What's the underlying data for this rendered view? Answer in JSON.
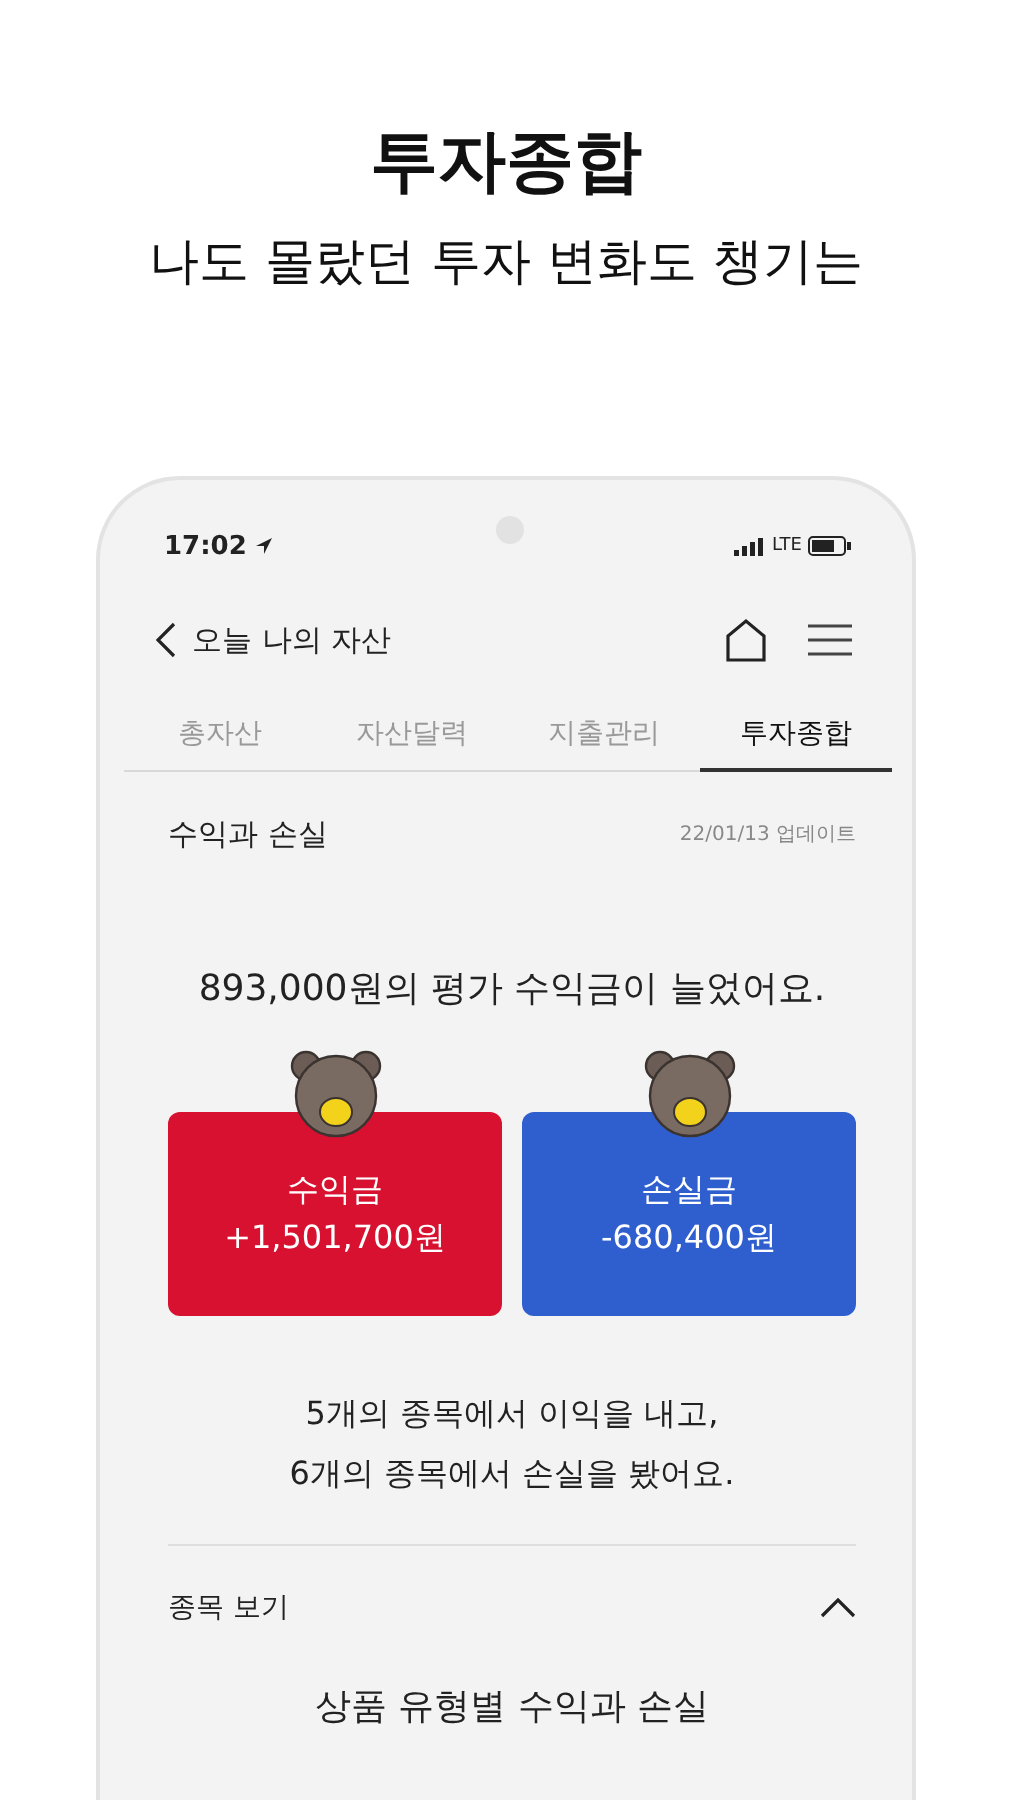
{
  "promo": {
    "title": "투자종합",
    "subtitle": "나도 몰랐던 투자 변화도 챙기는"
  },
  "status_bar": {
    "time": "17:02",
    "network": "LTE"
  },
  "nav": {
    "title": "오늘 나의 자산"
  },
  "tabs": [
    {
      "label": "총자산",
      "selected": false
    },
    {
      "label": "자산달력",
      "selected": false
    },
    {
      "label": "지출관리",
      "selected": false
    },
    {
      "label": "투자종합",
      "selected": true
    }
  ],
  "section": {
    "title": "수익과 손실",
    "updated": "22/01/13 업데이트"
  },
  "headline": "893,000원의 평가 수익금이 늘었어요.",
  "cards": [
    {
      "kind": "gain",
      "label": "수익금",
      "amount": "+1,501,700원"
    },
    {
      "kind": "loss",
      "label": "손실금",
      "amount": "-680,400원"
    }
  ],
  "summary": [
    "5개의 종목에서 이익을 내고,",
    "6개의 종목에서 손실을 봤어요."
  ],
  "accordion": {
    "label": "종목 보기",
    "expanded": true
  },
  "subheading": "상품 유형별 수익과 손실"
}
